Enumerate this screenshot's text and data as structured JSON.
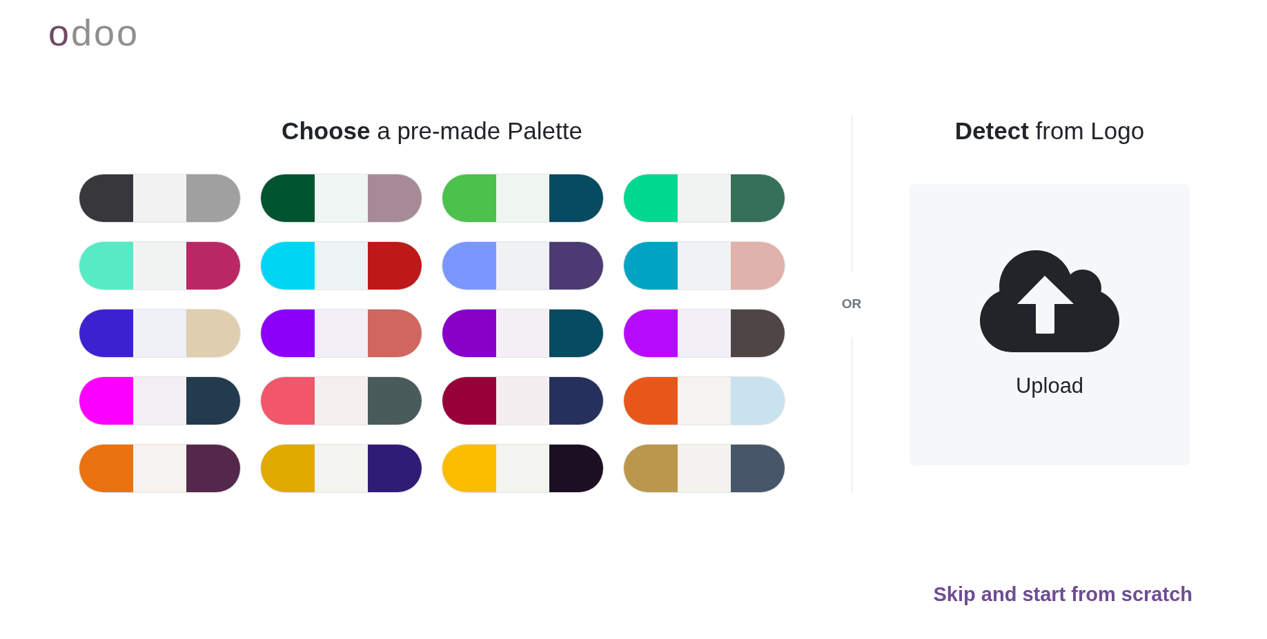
{
  "logo": [
    {
      "text": "o",
      "color": "#714b67"
    },
    {
      "text": "doo",
      "color": "#8f8f8f"
    }
  ],
  "palette_section": {
    "title": "**Choose** a pre-made Palette",
    "palettes": [
      {
        "swatches": [
          {
            "color": "#38373c"
          },
          {
            "color": "#f2f2f2"
          },
          {
            "color": "#a0a0a0"
          }
        ]
      },
      {
        "swatches": [
          {
            "color": "#005530"
          },
          {
            "color": "#eff6f3"
          },
          {
            "color": "#a68b96"
          }
        ]
      },
      {
        "swatches": [
          {
            "color": "#4cc14c"
          },
          {
            "color": "#eff6ef"
          },
          {
            "color": "#064b62"
          }
        ]
      },
      {
        "swatches": [
          {
            "color": "#00d890"
          },
          {
            "color": "#eff4f2"
          },
          {
            "color": "#377059"
          }
        ]
      },
      {
        "swatches": [
          {
            "color": "#56ebc5"
          },
          {
            "color": "#eff4f2"
          },
          {
            "color": "#b92865"
          }
        ]
      },
      {
        "swatches": [
          {
            "color": "#00d6f4"
          },
          {
            "color": "#eef3f5"
          },
          {
            "color": "#bd1919"
          }
        ]
      },
      {
        "swatches": [
          {
            "color": "#7a96ff"
          },
          {
            "color": "#eff1f5"
          },
          {
            "color": "#4c3b72"
          }
        ]
      },
      {
        "swatches": [
          {
            "color": "#00a3c2"
          },
          {
            "color": "#eff3f3"
          },
          {
            "color": "#dfb2ab"
          }
        ]
      },
      {
        "swatches": [
          {
            "color": "#3c21d0"
          },
          {
            "color": "#eff1f6"
          },
          {
            "color": "#dfceaf"
          }
        ]
      },
      {
        "swatches": [
          {
            "color": "#8c00f7"
          },
          {
            "color": "#f3eff6"
          },
          {
            "color": "#d16661"
          }
        ]
      },
      {
        "swatches": [
          {
            "color": "#8800c8"
          },
          {
            "color": "#f3eff5"
          },
          {
            "color": "#064b62"
          }
        ]
      },
      {
        "swatches": [
          {
            "color": "#b70bfe"
          },
          {
            "color": "#f3eff6"
          },
          {
            "color": "#4f4545"
          }
        ]
      },
      {
        "swatches": [
          {
            "color": "#fc00ff"
          },
          {
            "color": "#f4eef5"
          },
          {
            "color": "#233a4f"
          }
        ]
      },
      {
        "swatches": [
          {
            "color": "#f1566a"
          },
          {
            "color": "#f5efef"
          },
          {
            "color": "#495b5b"
          }
        ]
      },
      {
        "swatches": [
          {
            "color": "#970039"
          },
          {
            "color": "#f4eef1"
          },
          {
            "color": "#26305c"
          }
        ]
      },
      {
        "swatches": [
          {
            "color": "#e85719"
          },
          {
            "color": "#f5f2ef"
          },
          {
            "color": "#c8e2f0"
          }
        ]
      },
      {
        "swatches": [
          {
            "color": "#ea7210"
          },
          {
            "color": "#f5f2ef"
          },
          {
            "color": "#54284b"
          }
        ]
      },
      {
        "swatches": [
          {
            "color": "#e0a900"
          },
          {
            "color": "#f3f4ef"
          },
          {
            "color": "#2f1c77"
          }
        ]
      },
      {
        "swatches": [
          {
            "color": "#fabd00"
          },
          {
            "color": "#f3f3ef"
          },
          {
            "color": "#1c0f24"
          }
        ]
      },
      {
        "swatches": [
          {
            "color": "#bb974c"
          },
          {
            "color": "#f4f2ef"
          },
          {
            "color": "#475668"
          }
        ]
      }
    ]
  },
  "separator": {
    "label": "OR"
  },
  "logo_section": {
    "title": "**Detect** from Logo",
    "upload": {
      "label": "Upload"
    }
  },
  "skip_link": "Skip and start from scratch"
}
